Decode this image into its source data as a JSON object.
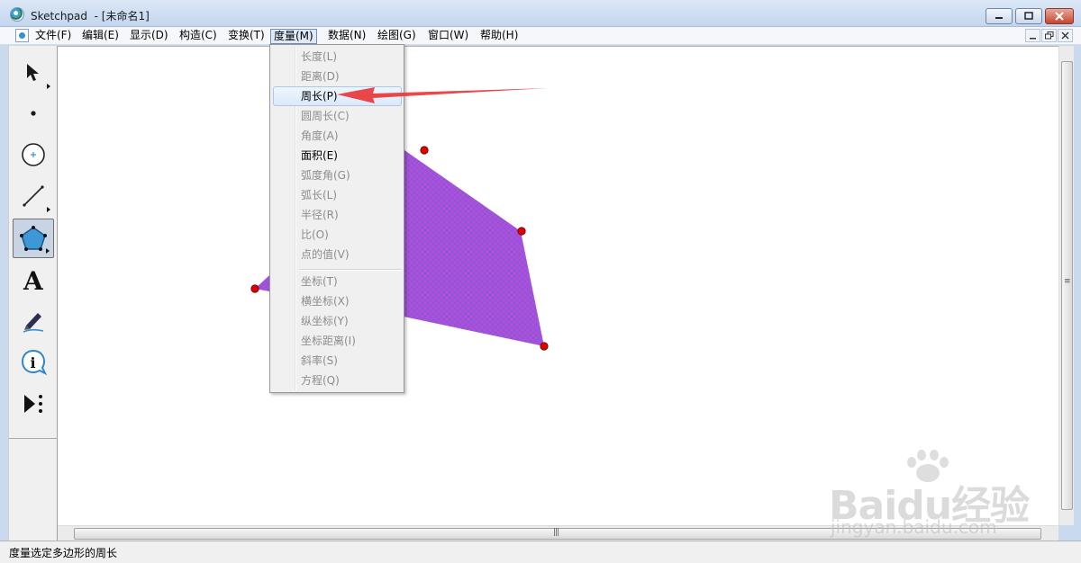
{
  "window": {
    "title": "Sketchpad  - [未命名1]"
  },
  "menubar": {
    "items": [
      "文件(F)",
      "编辑(E)",
      "显示(D)",
      "构造(C)",
      "变换(T)",
      "度量(M)",
      "数据(N)",
      "绘图(G)",
      "窗口(W)",
      "帮助(H)"
    ],
    "active": "度量(M)"
  },
  "measure_menu": {
    "items": [
      {
        "label": "长度(L)",
        "enabled": false
      },
      {
        "label": "距离(D)",
        "enabled": false
      },
      {
        "label": "周长(P)",
        "enabled": true,
        "highlighted": true
      },
      {
        "label": "圆周长(C)",
        "enabled": false
      },
      {
        "label": "角度(A)",
        "enabled": false
      },
      {
        "label": "面积(E)",
        "enabled": true
      },
      {
        "label": "弧度角(G)",
        "enabled": false
      },
      {
        "label": "弧长(L)",
        "enabled": false
      },
      {
        "label": "半径(R)",
        "enabled": false
      },
      {
        "label": "比(O)",
        "enabled": false
      },
      {
        "label": "点的值(V)",
        "enabled": false
      },
      {
        "label": "坐标(T)",
        "enabled": false
      },
      {
        "label": "横坐标(X)",
        "enabled": false
      },
      {
        "label": "纵坐标(Y)",
        "enabled": false
      },
      {
        "label": "坐标距离(I)",
        "enabled": false
      },
      {
        "label": "斜率(S)",
        "enabled": false
      },
      {
        "label": "方程(Q)",
        "enabled": false
      }
    ]
  },
  "toolbox": {
    "tools": [
      {
        "icon": "arrow-select-icon",
        "selected": false
      },
      {
        "icon": "point-icon",
        "selected": false
      },
      {
        "icon": "compass-circle-icon",
        "selected": false
      },
      {
        "icon": "straightedge-icon",
        "selected": false
      },
      {
        "icon": "polygon-icon",
        "selected": true
      },
      {
        "icon": "text-icon",
        "selected": false
      },
      {
        "icon": "marker-icon",
        "selected": false
      },
      {
        "icon": "information-icon",
        "selected": false
      },
      {
        "icon": "custom-tool-icon",
        "selected": false
      }
    ]
  },
  "canvas": {
    "polygon_fill_color": "#b14fdc",
    "point_color": "#e00000"
  },
  "status": {
    "text": "度量选定多边形的周长"
  },
  "watermark": {
    "brand": "Baidu经验",
    "url": "jingyan.baidu.com"
  },
  "colors": {
    "annotation_arrow": "#e8383b",
    "menu_highlight": "#dbe9f9"
  }
}
